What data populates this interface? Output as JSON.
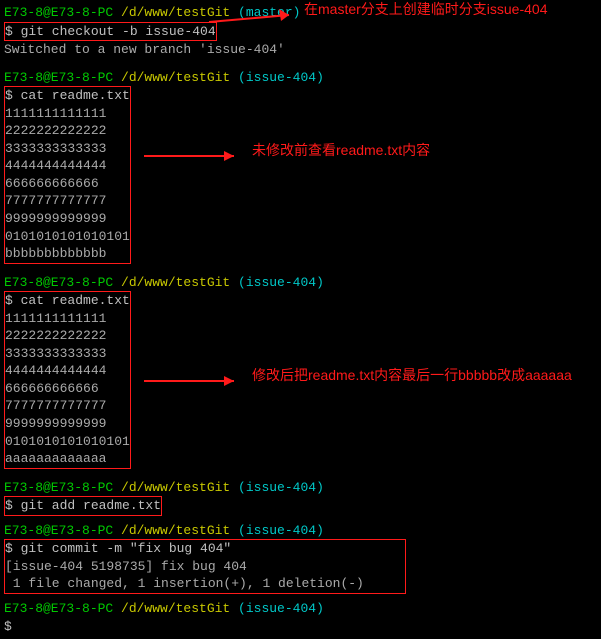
{
  "prompt1": {
    "user": "E73-8@E73-8-PC",
    "path": " /d/www/testGit",
    "branch": " (master)"
  },
  "cmd1": "$ git checkout -b issue-404",
  "out1": "Switched to a new branch 'issue-404'",
  "annot1": "在master分支上创建临时分支issue-404",
  "prompt2": {
    "user": "E73-8@E73-8-PC",
    "path": " /d/www/testGit",
    "branch": " (issue-404)"
  },
  "cmd2": "$ cat readme.txt",
  "file1": [
    "1111111111111",
    "2222222222222",
    "3333333333333",
    "4444444444444",
    "666666666666",
    "7777777777777",
    "9999999999999",
    "0101010101010101",
    "bbbbbbbbbbbbb"
  ],
  "annot2": "未修改前查看readme.txt内容",
  "prompt3": {
    "user": "E73-8@E73-8-PC",
    "path": " /d/www/testGit",
    "branch": " (issue-404)"
  },
  "cmd3": "$ cat readme.txt",
  "file2": [
    "1111111111111",
    "2222222222222",
    "3333333333333",
    "4444444444444",
    "666666666666",
    "7777777777777",
    "9999999999999",
    "0101010101010101",
    "aaaaaaaaaaaaa"
  ],
  "annot3": "修改后把readme.txt内容最后一行bbbbb改成aaaaaa",
  "prompt4": {
    "user": "E73-8@E73-8-PC",
    "path": " /d/www/testGit",
    "branch": " (issue-404)"
  },
  "cmd4": "$ git add readme.txt",
  "prompt5": {
    "user": "E73-8@E73-8-PC",
    "path": " /d/www/testGit",
    "branch": " (issue-404)"
  },
  "cmd5": "$ git commit -m \"fix bug 404\"",
  "out5a": "[issue-404 5198735] fix bug 404",
  "out5b": " 1 file changed, 1 insertion(+), 1 deletion(-)",
  "prompt6": {
    "user": "E73-8@E73-8-PC",
    "path": " /d/www/testGit",
    "branch": " (issue-404)"
  },
  "cmd6": "$"
}
